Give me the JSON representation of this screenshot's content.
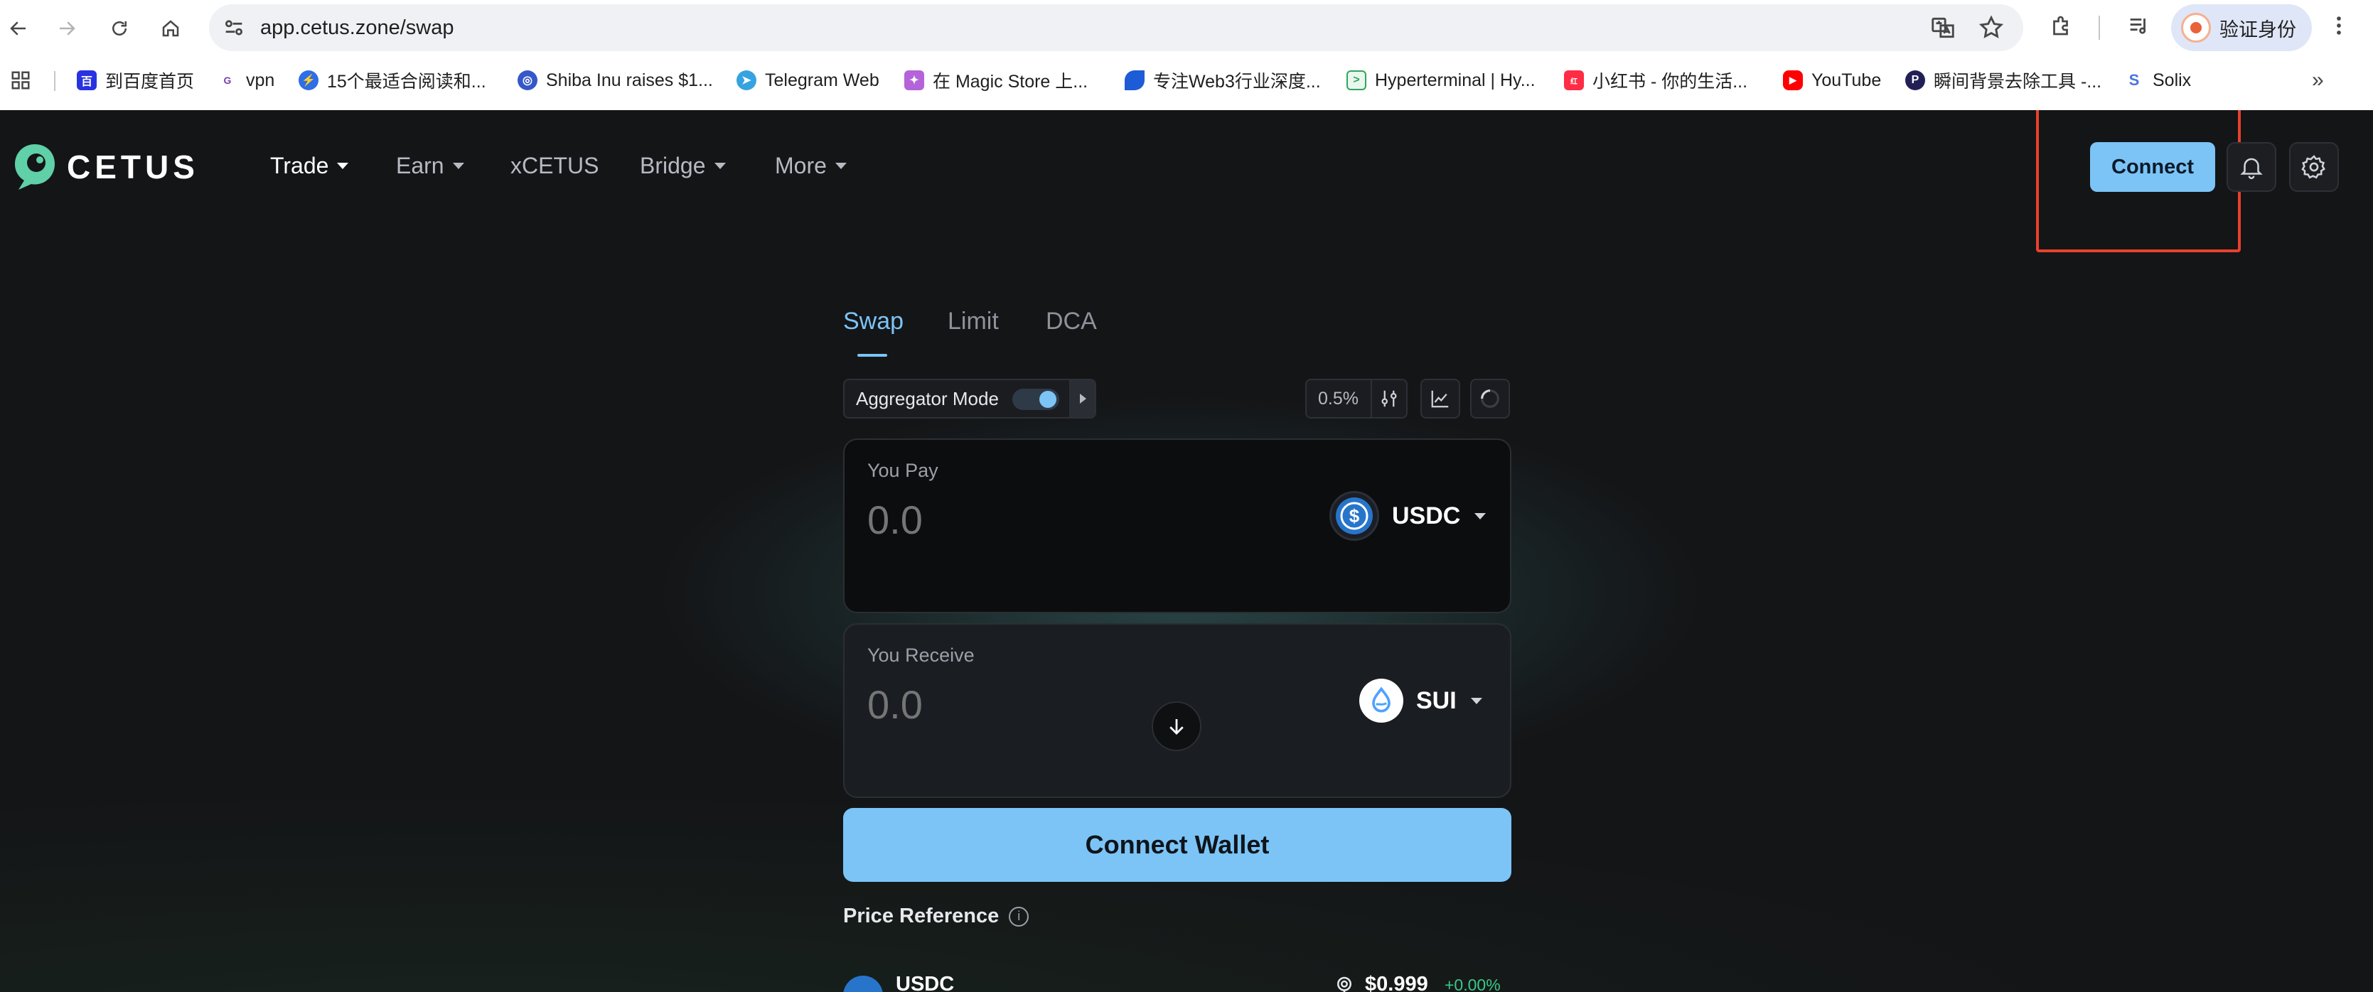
{
  "browser": {
    "url": "app.cetus.zone/swap",
    "profile_label": "验证身份",
    "bookmarks": [
      {
        "label": "到百度首页",
        "icon": "baidu-icon"
      },
      {
        "label": "vpn",
        "icon": "vpn-icon"
      },
      {
        "label": "15个最适合阅读和...",
        "icon": "lightning-icon"
      },
      {
        "label": "Shiba Inu raises $1...",
        "icon": "coin-icon"
      },
      {
        "label": "Telegram Web",
        "icon": "telegram-icon"
      },
      {
        "label": "在 Magic Store 上...",
        "icon": "magic-store-icon"
      },
      {
        "label": "专注Web3行业深度...",
        "icon": "wave-icon"
      },
      {
        "label": "Hyperterminal | Hy...",
        "icon": "terminal-icon"
      },
      {
        "label": "小红书 - 你的生活...",
        "icon": "xiaohongshu-icon"
      },
      {
        "label": "YouTube",
        "icon": "youtube-icon"
      },
      {
        "label": "瞬间背景去除工具 -...",
        "icon": "remove-bg-icon"
      },
      {
        "label": "Solix",
        "icon": "solix-icon"
      }
    ]
  },
  "header": {
    "logo_text": "CETUS",
    "nav": [
      {
        "label": "Trade",
        "dropdown": true
      },
      {
        "label": "Earn",
        "dropdown": true
      },
      {
        "label": "xCETUS",
        "dropdown": false
      },
      {
        "label": "Bridge",
        "dropdown": true
      },
      {
        "label": "More",
        "dropdown": true
      }
    ],
    "connect_label": "Connect"
  },
  "swap": {
    "tabs": [
      "Swap",
      "Limit",
      "DCA"
    ],
    "active_tab": "Swap",
    "aggregator_label": "Aggregator Mode",
    "aggregator_on": true,
    "slippage": "0.5%",
    "pay": {
      "label": "You Pay",
      "placeholder": "0.0",
      "token": "USDC"
    },
    "receive": {
      "label": "You Receive",
      "placeholder": "0.0",
      "token": "SUI"
    },
    "connect_wallet_label": "Connect Wallet",
    "price_reference_label": "Price Reference",
    "price_row": {
      "token": "USDC",
      "price": "$0.999",
      "change": "+0.00%"
    }
  },
  "colors": {
    "accent": "#7cc4f6",
    "background": "#141517",
    "highlight": "#e8412c",
    "positive": "#39c98a"
  }
}
